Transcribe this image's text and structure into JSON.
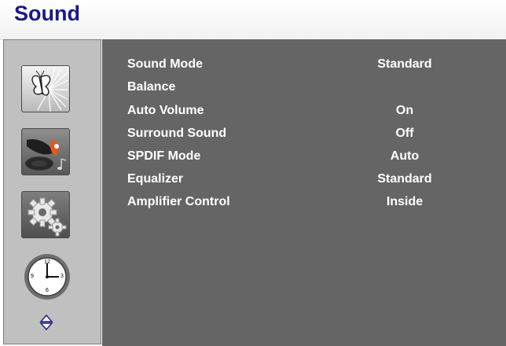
{
  "header": {
    "title": "Sound"
  },
  "sidebar": {
    "items": [
      {
        "name": "picture",
        "icon": "butterfly-icon"
      },
      {
        "name": "sound",
        "icon": "sound-icon"
      },
      {
        "name": "setup",
        "icon": "gears-icon"
      },
      {
        "name": "time",
        "icon": "clock-icon"
      }
    ],
    "clock_numbers": {
      "twelve": "12",
      "three": "3",
      "six": "6",
      "nine": "9"
    },
    "nav_icon": "updown-arrow-icon"
  },
  "menu": {
    "rows": [
      {
        "label": "Sound Mode",
        "value": "Standard"
      },
      {
        "label": "Balance",
        "value": ""
      },
      {
        "label": "Auto Volume",
        "value": "On"
      },
      {
        "label": "Surround Sound",
        "value": "Off"
      },
      {
        "label": "SPDIF Mode",
        "value": "Auto"
      },
      {
        "label": "Equalizer",
        "value": "Standard"
      },
      {
        "label": "Amplifier Control",
        "value": "Inside"
      }
    ]
  },
  "colors": {
    "title": "#1c1886",
    "sidebar_bg": "#c0c0c0",
    "content_bg": "#656565",
    "text": "#ffffff"
  }
}
